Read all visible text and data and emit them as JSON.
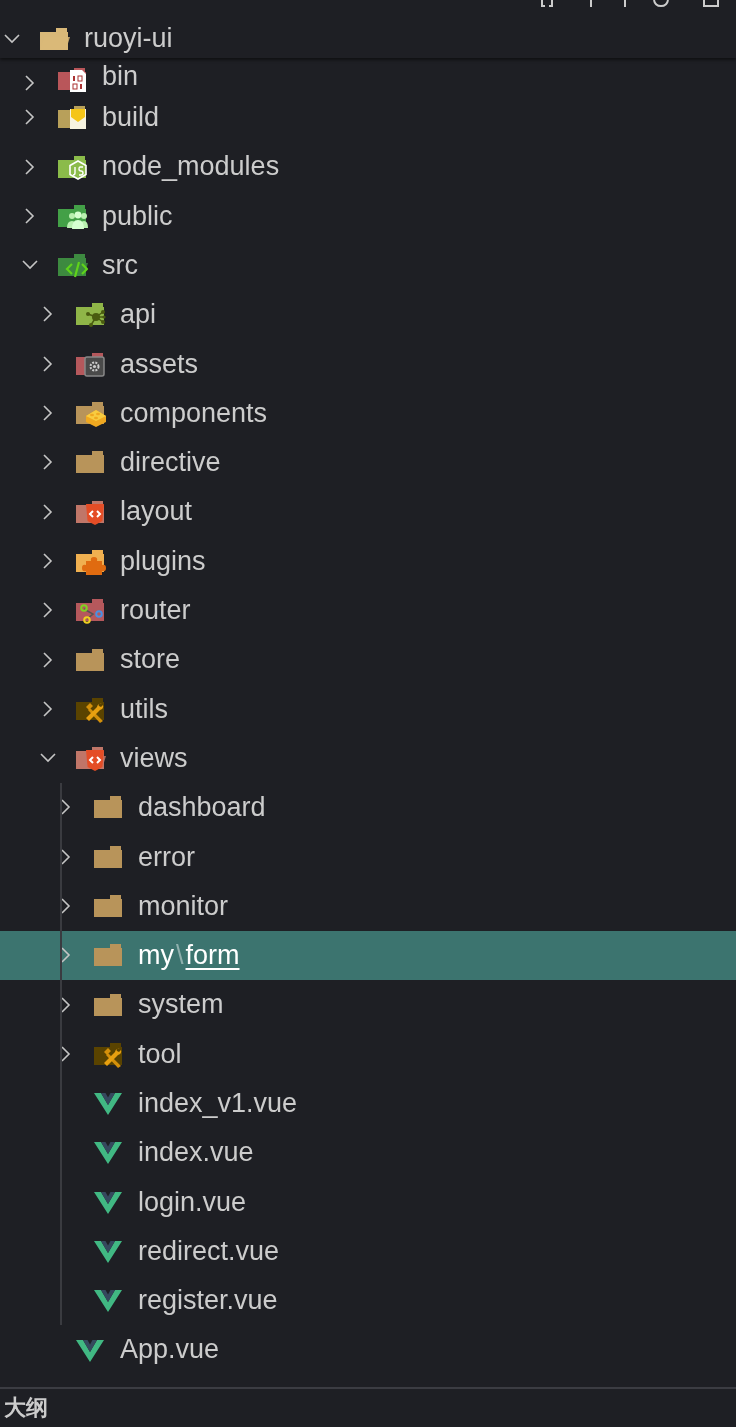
{
  "explorer": {
    "root": {
      "name": "ruoyi-ui",
      "expanded": true
    },
    "items": [
      {
        "name": "bin",
        "kind": "folder",
        "expanded": false,
        "selected": false
      },
      {
        "name": "build",
        "kind": "folder",
        "expanded": false,
        "selected": false
      },
      {
        "name": "node_modules",
        "kind": "folder",
        "expanded": false,
        "selected": false
      },
      {
        "name": "public",
        "kind": "folder",
        "expanded": false,
        "selected": false
      },
      {
        "name": "src",
        "kind": "folder",
        "expanded": true,
        "selected": false,
        "children": [
          {
            "name": "api",
            "kind": "folder",
            "expanded": false,
            "selected": false
          },
          {
            "name": "assets",
            "kind": "folder",
            "expanded": false,
            "selected": false
          },
          {
            "name": "components",
            "kind": "folder",
            "expanded": false,
            "selected": false
          },
          {
            "name": "directive",
            "kind": "folder",
            "expanded": false,
            "selected": false
          },
          {
            "name": "layout",
            "kind": "folder",
            "expanded": false,
            "selected": false
          },
          {
            "name": "plugins",
            "kind": "folder",
            "expanded": false,
            "selected": false
          },
          {
            "name": "router",
            "kind": "folder",
            "expanded": false,
            "selected": false
          },
          {
            "name": "store",
            "kind": "folder",
            "expanded": false,
            "selected": false
          },
          {
            "name": "utils",
            "kind": "folder",
            "expanded": false,
            "selected": false
          },
          {
            "name": "views",
            "kind": "folder",
            "expanded": true,
            "selected": false,
            "children": [
              {
                "name": "dashboard",
                "kind": "folder",
                "expanded": false,
                "selected": false
              },
              {
                "name": "error",
                "kind": "folder",
                "expanded": false,
                "selected": false
              },
              {
                "name": "monitor",
                "kind": "folder",
                "expanded": false,
                "selected": false
              },
              {
                "name": "my",
                "kind": "folder",
                "expanded": false,
                "selected": true,
                "compact": {
                  "separator": "\\",
                  "name": "form",
                  "underlined": true
                }
              },
              {
                "name": "system",
                "kind": "folder",
                "expanded": false,
                "selected": false
              },
              {
                "name": "tool",
                "kind": "folder",
                "expanded": false,
                "selected": false
              },
              {
                "name": "index_v1.vue",
                "kind": "file",
                "selected": false
              },
              {
                "name": "index.vue",
                "kind": "file",
                "selected": false
              },
              {
                "name": "login.vue",
                "kind": "file",
                "selected": false
              },
              {
                "name": "redirect.vue",
                "kind": "file",
                "selected": false
              },
              {
                "name": "register.vue",
                "kind": "file",
                "selected": false
              }
            ]
          },
          {
            "name": "App.vue",
            "kind": "file",
            "selected": false
          }
        ]
      }
    ]
  },
  "outline": {
    "title": "大纲"
  }
}
